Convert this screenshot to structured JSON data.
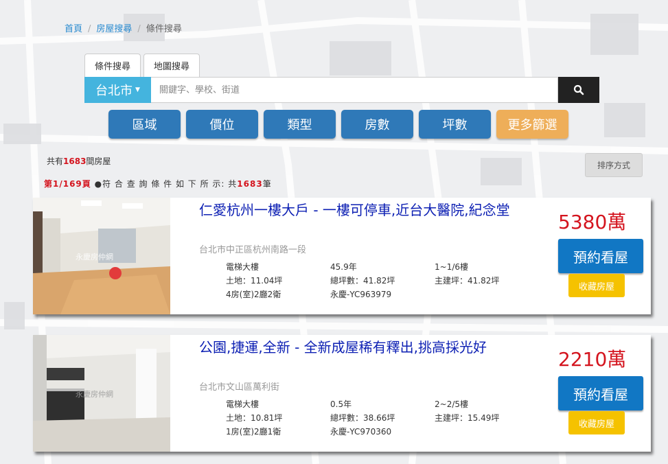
{
  "breadcrumb": {
    "home": "首頁",
    "house_search": "房屋搜尋",
    "current": "條件搜尋"
  },
  "tabs": {
    "condition": "條件搜尋",
    "map": "地圖搜尋"
  },
  "search": {
    "city": "台北市",
    "placeholder": "關鍵字、學校、街道"
  },
  "filters": {
    "area": "區域",
    "price": "價位",
    "type": "類型",
    "rooms": "房數",
    "size": "坪數",
    "more": "更多篩選"
  },
  "summary": {
    "total_prefix": "共有",
    "total_count": "1683",
    "total_suffix": "間房屋",
    "sort_label": "排序方式",
    "page_label": "第1/169頁",
    "page_text": "●符 合 查 詢 條 件 如 下 所 示: 共",
    "page_count": "1683",
    "page_unit": "筆"
  },
  "listings": [
    {
      "title": "仁愛杭州一樓大戶 - 一樓可停車,近台大醫院,紀念堂",
      "address": "台北市中正區杭州南路一段",
      "specs": [
        "電梯大樓",
        "45.9年",
        "1~1/6樓",
        "土地：11.04坪",
        "總坪數：41.82坪",
        "主建坪：41.82坪",
        "4房(室)2廳2衛",
        "永慶-YC963979"
      ],
      "price": "5380萬",
      "book_label": "預約看屋",
      "fav_label": "收藏房屋",
      "watermark": "永慶房仲網"
    },
    {
      "title": "公園,捷運,全新 - 全新成屋稀有釋出,挑高採光好",
      "address": "台北市文山區萬利街",
      "specs": [
        "電梯大樓",
        "0.5年",
        "2~2/5樓",
        "土地：10.81坪",
        "總坪數：38.66坪",
        "主建坪：15.49坪",
        "1房(室)2廳1衛",
        "永慶-YC970360"
      ],
      "price": "2210萬",
      "book_label": "預約看屋",
      "fav_label": "收藏房屋",
      "watermark": "永慶房仲網"
    }
  ],
  "icons": {
    "search": "search-icon",
    "caret": "caret-down-icon"
  },
  "colors": {
    "accent": "#44b4de",
    "filter": "#2f79b8",
    "more": "#eeae59",
    "price": "#d4141e",
    "title": "#0c1fb3",
    "book": "#1177c4",
    "fav": "#f5c200"
  }
}
